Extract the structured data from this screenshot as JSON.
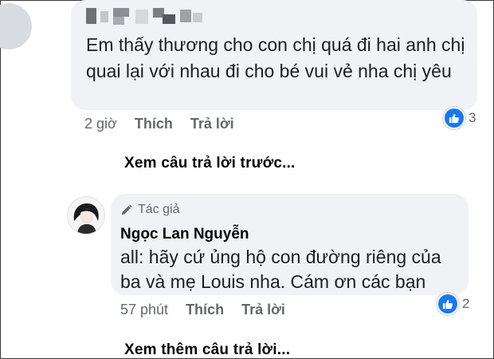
{
  "comment": {
    "text": "Em thấy thương cho con chị quá đi hai anh chị quai lại với nhau đi cho bé vui vẻ nha chị yêu",
    "time": "2 giờ",
    "like_label": "Thích",
    "reply_label": "Trả lời",
    "reaction_count": "3"
  },
  "view_previous": "Xem câu trả lời trước...",
  "reply": {
    "badge": "Tác giả",
    "author": "Ngọc Lan Nguyễn",
    "text": "all: hãy cứ ủng hộ con đường riêng của ba và mẹ Louis nha. Cám ơn các bạn",
    "time": "57 phút",
    "like_label": "Thích",
    "reply_label": "Trả lời",
    "reaction_count": "2"
  },
  "view_more": "Xem thêm câu trả lời...",
  "colors": {
    "bubble": "#f0f2f5",
    "meta_text": "#65676b",
    "like_blue": "#1877f2"
  },
  "icons": {
    "reaction": "thumbs-up-icon",
    "author_badge": "pencil-icon"
  }
}
